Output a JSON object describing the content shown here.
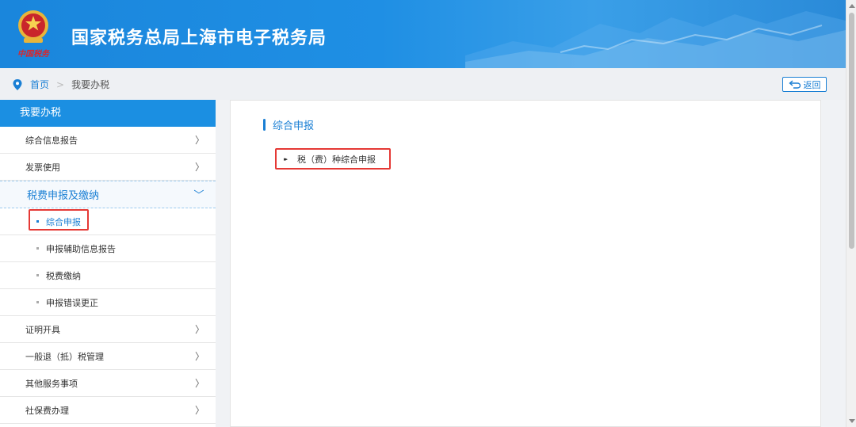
{
  "header": {
    "title": "国家税务总局上海市电子税务局",
    "emblem_text": "中国税务"
  },
  "breadcrumb": {
    "home": "首页",
    "separator": ">",
    "current": "我要办税"
  },
  "back_button": {
    "label": "返回"
  },
  "sidebar": {
    "heading": "我要办税",
    "items_top": [
      {
        "label": "综合信息报告",
        "chevron": "〉"
      },
      {
        "label": "发票使用",
        "chevron": "〉"
      }
    ],
    "open_item": {
      "label": "税费申报及缴纳",
      "chevron": "〉"
    },
    "sub_items": [
      {
        "label": "综合申报",
        "active": true
      },
      {
        "label": "申报辅助信息报告"
      },
      {
        "label": "税费缴纳"
      },
      {
        "label": "申报错误更正"
      }
    ],
    "items_bottom": [
      {
        "label": "证明开具",
        "chevron": "〉"
      },
      {
        "label": "一般退（抵）税管理",
        "chevron": "〉"
      },
      {
        "label": "其他服务事项",
        "chevron": "〉"
      },
      {
        "label": "社保费办理",
        "chevron": "〉"
      }
    ]
  },
  "main": {
    "section_title": "综合申报",
    "links": [
      {
        "label": "税（费）种综合申报",
        "arrow": "▸▸"
      }
    ]
  },
  "colors": {
    "accent": "#1a7fd4",
    "header_blue": "#1b8fe2",
    "highlight_red": "#e53935"
  }
}
